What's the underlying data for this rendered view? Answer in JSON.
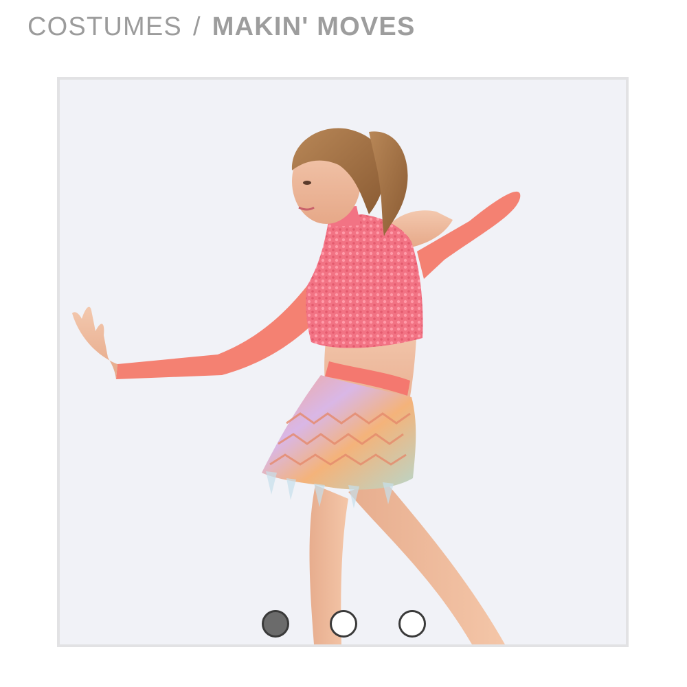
{
  "breadcrumb": {
    "parent": "COSTUMES",
    "separator": "/",
    "current": "MAKIN' MOVES"
  },
  "gallery": {
    "image_count": 3,
    "active_index": 0,
    "colors": {
      "background": "#f1f2f7",
      "frame": "#e2e2e4",
      "costume_coral": "#f2786a",
      "sequin_pink": "#f2727f",
      "dot_active": "#6b6b6b",
      "dot_border": "#3a3a3a"
    }
  }
}
